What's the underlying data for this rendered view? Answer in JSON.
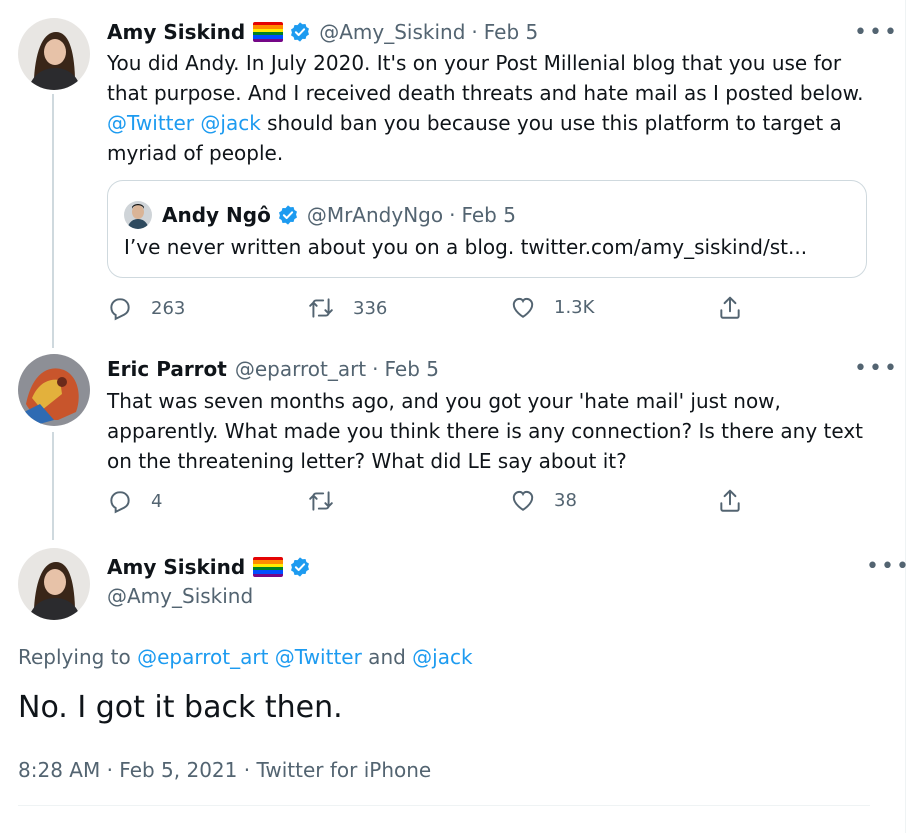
{
  "tweets": [
    {
      "name": "Amy Siskind",
      "handle": "@Amy_Siskind",
      "time": "Feb 5",
      "sep": "·",
      "text_lines": [
        "You did Andy.  In July 2020.  It's on your Post Millenial blog that you use for",
        "that purpose.  And I received death threats and hate mail as I posted below."
      ],
      "mention1": "@Twitter",
      "mention2": "@jack",
      "line3_rest": " should ban you because you use this platform to target a",
      "line4": "myriad of people.",
      "quote": {
        "name": "Andy Ngô",
        "handle": "@MrAndyNgo",
        "time": "Feb 5",
        "text": "I’ve never written about you on a blog. twitter.com/amy_siskind/st..."
      },
      "replies": "263",
      "retweets": "336",
      "likes": "1.3K"
    },
    {
      "name": "Eric Parrot",
      "handle": "@eparrot_art",
      "time": "Feb 5",
      "text_lines": [
        "That was seven months ago, and you got your 'hate mail' just now,",
        "apparently. What made you think there is any connection? Is there any text",
        "on the threatening letter? What did LE say about it?"
      ],
      "replies": "4",
      "retweets": "",
      "likes": "38"
    }
  ],
  "focus": {
    "name": "Amy Siskind",
    "handle": "@Amy_Siskind",
    "replying_prefix": "Replying to ",
    "replying_to1": "@eparrot_art",
    "replying_to2": "@Twitter",
    "replying_and": " and ",
    "replying_to3": "@jack",
    "text": "No.  I got it back then.",
    "meta": "8:28 AM · Feb 5, 2021 · Twitter for iPhone"
  },
  "more_label": "•••",
  "colors": {
    "accent": "#1d9bf0",
    "muted": "#536471",
    "text": "#0f1419",
    "border": "#cfd9de"
  },
  "icons": [
    "verified-icon",
    "pride-flag-icon",
    "reply-icon",
    "retweet-icon",
    "like-icon",
    "share-icon",
    "more-icon"
  ]
}
